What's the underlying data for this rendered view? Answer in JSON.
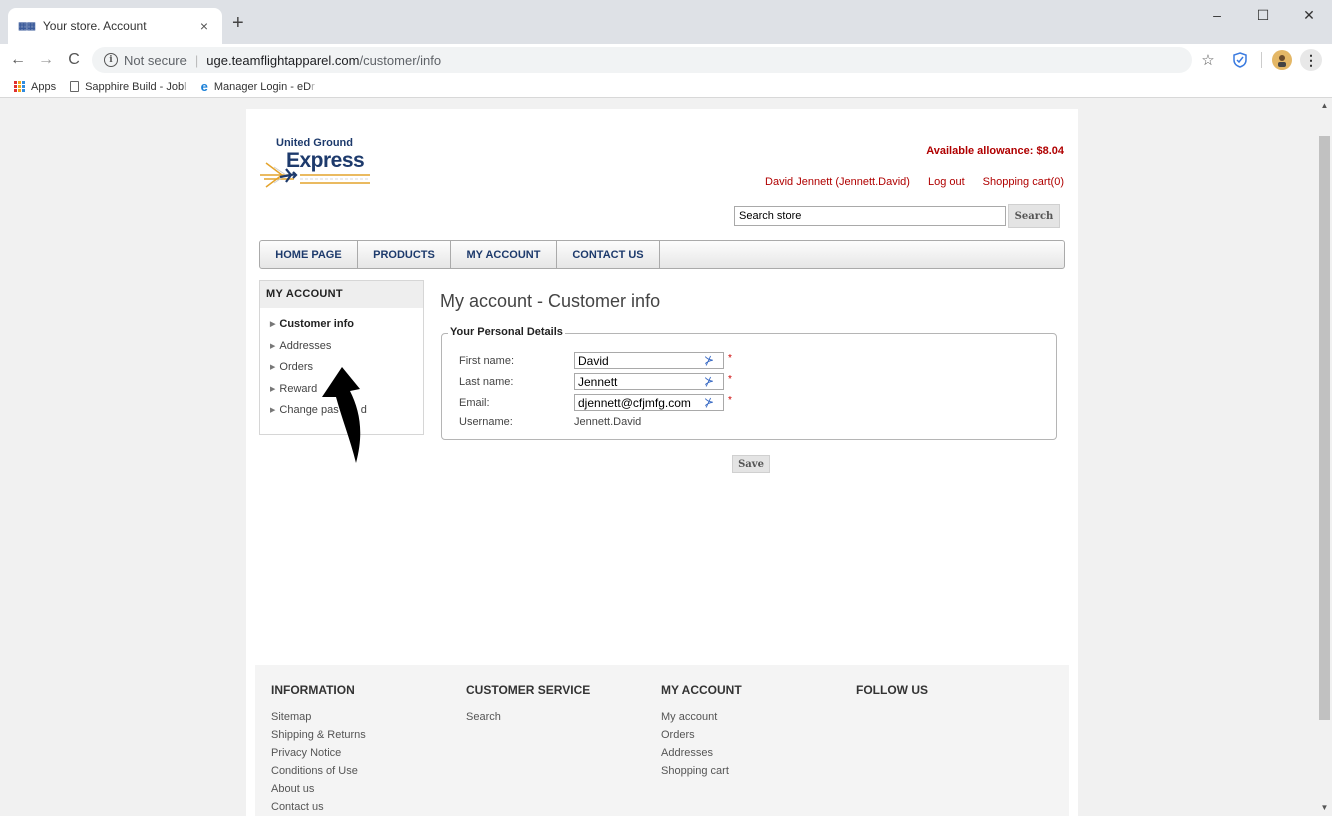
{
  "browser": {
    "tab_title": "Your store. Account",
    "tab_favicon": "grid-logo-icon",
    "close_tab": "×",
    "new_tab": "+",
    "window_controls": {
      "minimize": "–",
      "maximize": "☐",
      "close": "✕"
    },
    "back": "←",
    "forward": "→",
    "reload": "C",
    "security_info": "i",
    "security_text": "Not secure",
    "url_separator": "|",
    "url_host": "uge.teamflightapparel.com",
    "url_path": "/customer/info",
    "star": "☆",
    "menu": "⋮",
    "bookmarks": [
      {
        "label": "Apps"
      },
      {
        "label": "Sapphire Build - Job",
        "fade": "l"
      },
      {
        "label": "Manager Login - eD",
        "fade": "r"
      }
    ]
  },
  "store": {
    "logo_line1": "United Ground",
    "logo_line2": "Express",
    "allowance": "Available allowance: $8.04",
    "user_link": "David Jennett (Jennett.David)",
    "logout": "Log out",
    "cart": "Shopping cart(0)",
    "search_placeholder": "Search store",
    "search_button": "Search",
    "nav": [
      "HOME PAGE",
      "PRODUCTS",
      "MY ACCOUNT",
      "CONTACT US"
    ]
  },
  "sidebar": {
    "title": "MY ACCOUNT",
    "items": [
      "Customer info",
      "Addresses",
      "Orders",
      "Reward",
      "Change pas",
      "d"
    ]
  },
  "main": {
    "title": "My account - Customer info",
    "legend": "Your Personal Details",
    "first_name_label": "First name:",
    "first_name": "David",
    "last_name_label": "Last name:",
    "last_name": "Jennett",
    "email_label": "Email:",
    "email": "djennett@cfjmfg.com",
    "username_label": "Username:",
    "username": "Jennett.David",
    "required": "*",
    "save": "Save"
  },
  "footer": {
    "information": {
      "title": "INFORMATION",
      "links": [
        "Sitemap",
        "Shipping & Returns",
        "Privacy Notice",
        "Conditions of Use",
        "About us",
        "Contact us"
      ]
    },
    "customer_service": {
      "title": "CUSTOMER SERVICE",
      "links": [
        "Search"
      ]
    },
    "my_account": {
      "title": "MY ACCOUNT",
      "links": [
        "My account",
        "Orders",
        "Addresses",
        "Shopping cart"
      ]
    },
    "follow_us": {
      "title": "FOLLOW US"
    }
  },
  "colors": {
    "accent_red": "#b00000",
    "nav_blue": "#1d3a6c",
    "logo_gold": "#e4a32b"
  }
}
